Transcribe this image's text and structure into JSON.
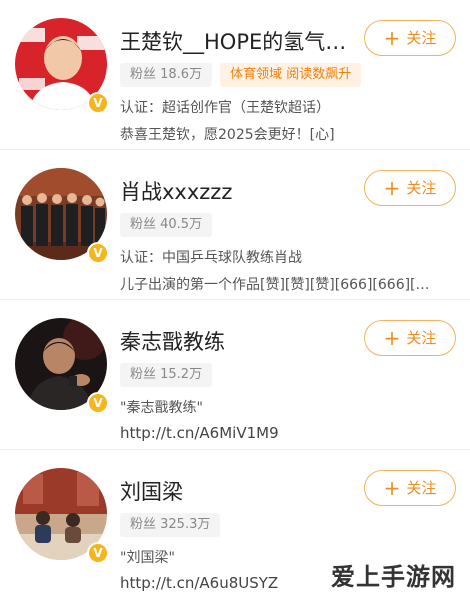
{
  "users": [
    {
      "name": "王楚钦__HOPE的氢气球…",
      "fans": "粉丝 18.6万",
      "tag": "体育领域 阅读数飙升",
      "line1": "认证：超话创作官（王楚钦超话）",
      "line2": "恭喜王楚钦，愿2025会更好！[心]",
      "follow": "关注",
      "avatar_icon": "person-avatar-icon",
      "badge": "V"
    },
    {
      "name": "肖战xxxzzz",
      "fans": "粉丝 40.5万",
      "line1": "认证：中国乒乓球队教练肖战",
      "line2": "儿子出演的第一个作品[赞][赞][赞][666][666][…",
      "follow": "关注",
      "avatar_icon": "group-avatar-icon",
      "badge": "V"
    },
    {
      "name": "秦志戬教练",
      "fans": "粉丝 15.2万",
      "line1": "\"秦志戬教练\"",
      "line2": "http://t.cn/A6MiV1M9",
      "follow": "关注",
      "avatar_icon": "coach-avatar-icon",
      "badge": "V"
    },
    {
      "name": "刘国梁",
      "fans": "粉丝 325.3万",
      "line1": "\"刘国梁\"",
      "line2": "http://t.cn/A6u8USYZ",
      "follow": "关注",
      "avatar_icon": "photo-avatar-icon",
      "badge": "V"
    }
  ],
  "watermark": "爱上手游网",
  "colors": {
    "accent": "#ef8d1f",
    "badge": "#f6b51b",
    "hot_tag_bg": "#fff1e3"
  }
}
